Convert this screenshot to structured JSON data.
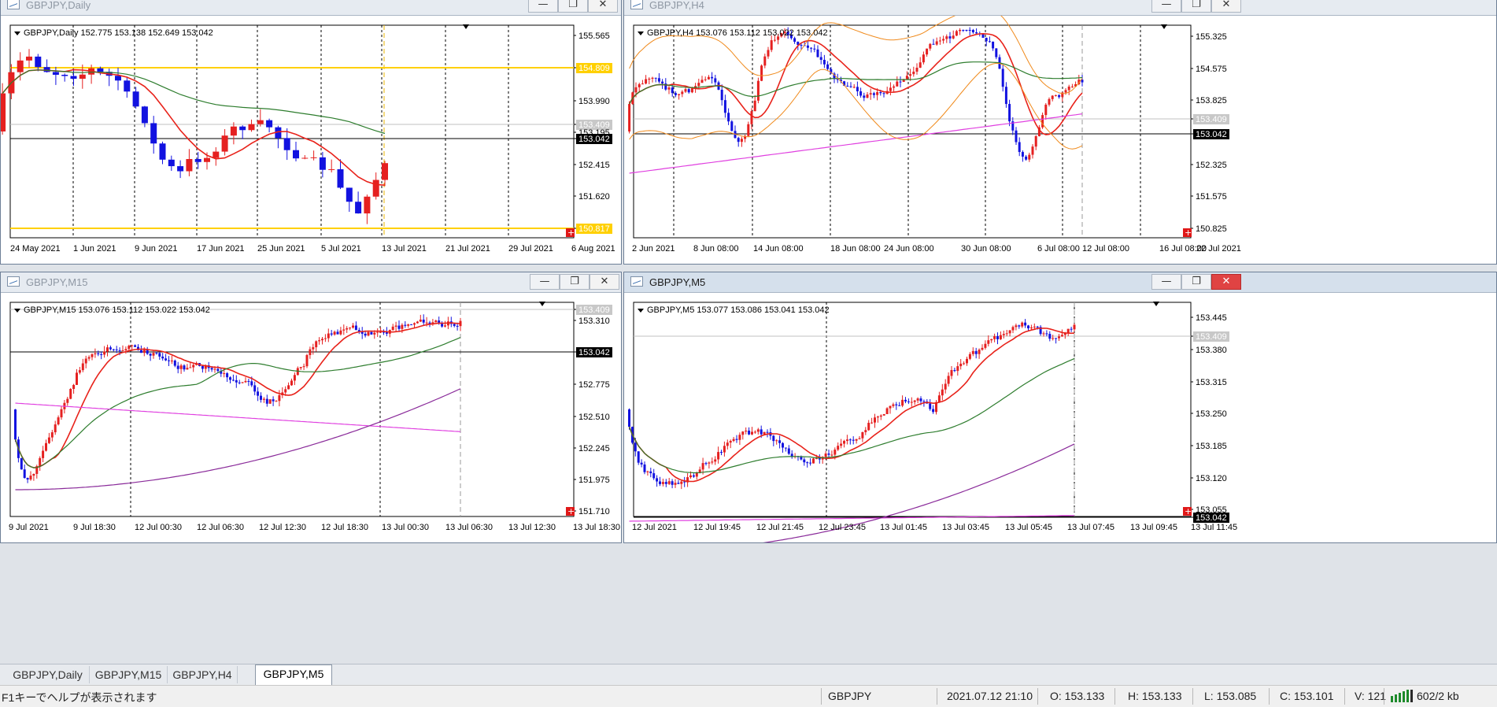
{
  "windows": {
    "daily": {
      "title": "GBPJPY,Daily",
      "info": "GBPJPY,Daily  152.775 153.138 152.649 153.042",
      "price_labels": [
        "155.565",
        "154.809",
        "153.990",
        "153.409",
        "153.195",
        "153.042",
        "152.415",
        "151.620",
        "150.817"
      ],
      "time_labels": [
        "24 May 2021",
        "1 Jun 2021",
        "9 Jun 2021",
        "17 Jun 2021",
        "25 Jun 2021",
        "5 Jul 2021",
        "13 Jul 2021",
        "21 Jul 2021",
        "29 Jul 2021",
        "6 Aug 2021"
      ]
    },
    "h4": {
      "title": "GBPJPY,H4",
      "info": "GBPJPY,H4  153.076 153.112 153.022 153.042",
      "price_labels": [
        "155.325",
        "154.575",
        "153.825",
        "153.409",
        "153.042",
        "152.325",
        "151.575",
        "150.825"
      ],
      "time_labels": [
        "2 Jun 2021",
        "8 Jun 08:00",
        "14 Jun 08:00",
        "18 Jun 08:00",
        "24 Jun 08:00",
        "30 Jun 08:00",
        "6 Jul 08:00",
        "12 Jul 08:00",
        "16 Jul 08:00",
        "22 Jul 2021"
      ]
    },
    "m15": {
      "title": "GBPJPY,M15",
      "info": "GBPJPY,M15  153.076 153.112 153.022 153.042",
      "price_labels": [
        "153.409",
        "153.310",
        "153.042",
        "152.775",
        "152.510",
        "152.245",
        "151.975",
        "151.710"
      ],
      "time_labels": [
        "9 Jul 2021",
        "9 Jul 18:30",
        "12 Jul 00:30",
        "12 Jul 06:30",
        "12 Jul 12:30",
        "12 Jul 18:30",
        "13 Jul 00:30",
        "13 Jul 06:30",
        "13 Jul 12:30",
        "13 Jul 18:30"
      ]
    },
    "m5": {
      "title": "GBPJPY,M5",
      "info": "GBPJPY,M5  153.077 153.086 153.041 153.042",
      "price_labels": [
        "153.445",
        "153.409",
        "153.380",
        "153.315",
        "153.250",
        "153.185",
        "153.120",
        "153.055",
        "153.042"
      ],
      "time_labels": [
        "12 Jul 2021",
        "12 Jul 19:45",
        "12 Jul 21:45",
        "12 Jul 23:45",
        "13 Jul 01:45",
        "13 Jul 03:45",
        "13 Jul 05:45",
        "13 Jul 07:45",
        "13 Jul 09:45",
        "13 Jul 11:45"
      ]
    }
  },
  "window_buttons": {
    "minimize": "—",
    "restore": "❐",
    "close": "✕"
  },
  "tabs": [
    "GBPJPY,Daily",
    "GBPJPY,M15",
    "GBPJPY,H4",
    "GBPJPY,M5"
  ],
  "status": {
    "help": "F1キーでヘルプが表示されます",
    "symbol": "GBPJPY",
    "datetime": "2021.07.12 21:10",
    "open": "O: 153.133",
    "high": "H: 153.133",
    "low": "L: 153.085",
    "close": "C: 153.101",
    "volume": "V: 121",
    "traffic": "602/2 kb"
  },
  "colors": {
    "bull": "#e52020",
    "bear": "#1212e0",
    "ma_fast": "#e8221a",
    "ma_mid": "#2e7d2e",
    "ma_slow": "#e040e0",
    "ma_slow2": "#8a2b9a",
    "bands": "#f08a1c",
    "hline": "#ffd000",
    "bid_line": "#000000",
    "ask_line": "#c0c0c0"
  }
}
